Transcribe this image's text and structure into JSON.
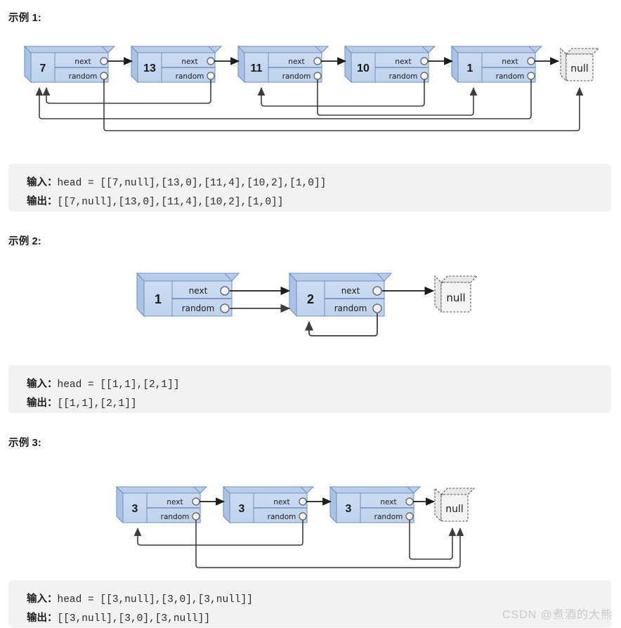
{
  "page": {
    "watermark": "CSDN @煮酒的大熊",
    "node_labels": {
      "next": "next",
      "random": "random",
      "null": "null"
    },
    "colors": {
      "node_face": "#c3d5ef",
      "node_top": "#b5cbe9",
      "node_side": "#aac3e4",
      "node_border": "#6f8fbf",
      "port_fill": "#f4f4f4",
      "arrow": "#1b1b1b",
      "random_arrow": "#4a4a4a",
      "null_fill": "#f2f2f2",
      "null_border": "#5a5a5a",
      "code_bg": "#f2f2f2",
      "watermark": "#c9c9c9"
    }
  },
  "examples": [
    {
      "id": "example-1",
      "title": "示例 1:",
      "input_label": "输入：",
      "output_label": "输出：",
      "input_value": "head = [[7,null],[13,0],[11,4],[10,2],[1,0]]",
      "output_value": "[[7,null],[13,0],[11,4],[10,2],[1,0]]",
      "nodes": [
        {
          "value": "7",
          "next": "node-1",
          "random": "null"
        },
        {
          "value": "13",
          "next": "node-2",
          "random": "node-0"
        },
        {
          "value": "11",
          "next": "node-3",
          "random": "node-4"
        },
        {
          "value": "10",
          "next": "node-4",
          "random": "node-2"
        },
        {
          "value": "1",
          "next": "null",
          "random": "node-0"
        }
      ]
    },
    {
      "id": "example-2",
      "title": "示例 2:",
      "input_label": "输入：",
      "output_label": "输出：",
      "input_value": "head = [[1,1],[2,1]]",
      "output_value": "[[1,1],[2,1]]",
      "nodes": [
        {
          "value": "1",
          "next": "node-1",
          "random": "node-1"
        },
        {
          "value": "2",
          "next": "null",
          "random": "node-1"
        }
      ]
    },
    {
      "id": "example-3",
      "title": "示例 3:",
      "input_label": "输入：",
      "output_label": "输出：",
      "input_value": "head = [[3,null],[3,0],[3,null]]",
      "output_value": "[[3,null],[3,0],[3,null]]",
      "nodes": [
        {
          "value": "3",
          "next": "node-1",
          "random": "null"
        },
        {
          "value": "3",
          "next": "node-2",
          "random": "node-0"
        },
        {
          "value": "3",
          "next": "null",
          "random": "null"
        }
      ]
    }
  ]
}
